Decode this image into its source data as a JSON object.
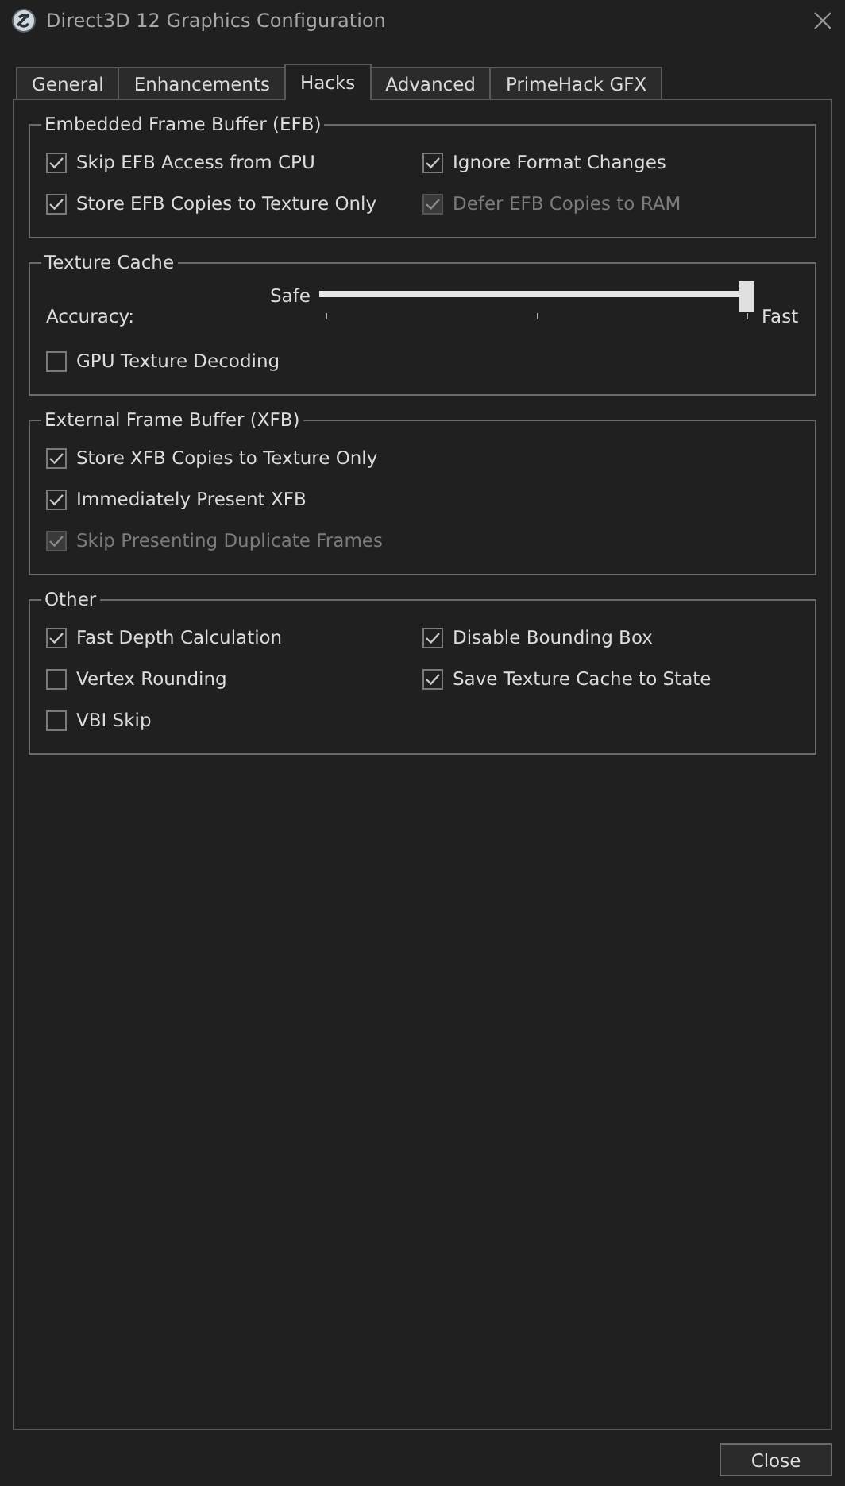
{
  "window": {
    "title": "Direct3D 12 Graphics Configuration"
  },
  "tabs": [
    {
      "label": "General",
      "selected": false
    },
    {
      "label": "Enhancements",
      "selected": false
    },
    {
      "label": "Hacks",
      "selected": true
    },
    {
      "label": "Advanced",
      "selected": false
    },
    {
      "label": "PrimeHack GFX",
      "selected": false
    }
  ],
  "groups": [
    {
      "title": "Embedded Frame Buffer (EFB)",
      "kind": "grid",
      "items": [
        {
          "label": "Skip EFB Access from CPU",
          "checked": true,
          "disabled": false
        },
        {
          "label": "Ignore Format Changes",
          "checked": true,
          "disabled": false
        },
        {
          "label": "Store EFB Copies to Texture Only",
          "checked": true,
          "disabled": false
        },
        {
          "label": "Defer EFB Copies to RAM",
          "checked": true,
          "disabled": true
        }
      ]
    },
    {
      "title": "Texture Cache",
      "kind": "list",
      "slider": {
        "label": "Accuracy:",
        "min_label": "Safe",
        "max_label": "Fast",
        "level": 1
      },
      "items": [
        {
          "label": "GPU Texture Decoding",
          "checked": false,
          "disabled": false
        }
      ]
    },
    {
      "title": "External Frame Buffer (XFB)",
      "kind": "list",
      "items": [
        {
          "label": "Store XFB Copies to Texture Only",
          "checked": true,
          "disabled": false
        },
        {
          "label": "Immediately Present XFB",
          "checked": true,
          "disabled": false
        },
        {
          "label": "Skip Presenting Duplicate Frames",
          "checked": true,
          "disabled": true
        }
      ]
    },
    {
      "title": "Other",
      "kind": "grid",
      "items": [
        {
          "label": "Fast Depth Calculation",
          "checked": true,
          "disabled": false
        },
        {
          "label": "Disable Bounding Box",
          "checked": true,
          "disabled": false
        },
        {
          "label": "Vertex Rounding",
          "checked": false,
          "disabled": false
        },
        {
          "label": "Save Texture Cache to State",
          "checked": true,
          "disabled": false
        },
        {
          "label": "VBI Skip",
          "checked": false,
          "disabled": false
        }
      ]
    }
  ],
  "buttons": [
    "Close"
  ]
}
